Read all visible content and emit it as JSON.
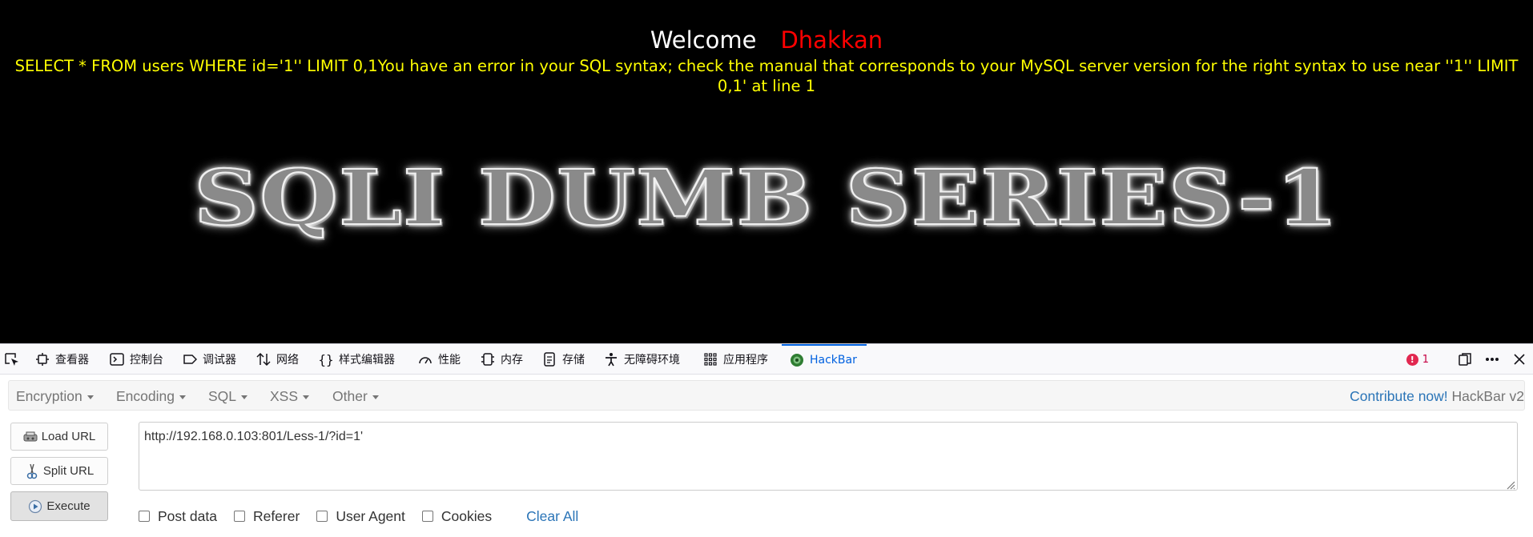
{
  "page": {
    "welcome": "Welcome",
    "user": "Dhakkan",
    "sql_error": "SELECT * FROM users WHERE id='1'' LIMIT 0,1You have an error in your SQL syntax; check the manual that corresponds to your MySQL server version for the right syntax to use near ''1'' LIMIT 0,1' at line 1",
    "banner": "SQLI DUMB SERIES-1"
  },
  "devtools": {
    "tabs": [
      {
        "label": "查看器",
        "icon": "inspector-icon"
      },
      {
        "label": "控制台",
        "icon": "console-icon"
      },
      {
        "label": "调试器",
        "icon": "debugger-icon"
      },
      {
        "label": "网络",
        "icon": "network-icon"
      },
      {
        "label": "样式编辑器",
        "icon": "style-editor-icon"
      },
      {
        "label": "性能",
        "icon": "performance-icon"
      },
      {
        "label": "内存",
        "icon": "memory-icon"
      },
      {
        "label": "存储",
        "icon": "storage-icon"
      },
      {
        "label": "无障碍环境",
        "icon": "accessibility-icon"
      },
      {
        "label": "应用程序",
        "icon": "application-icon"
      },
      {
        "label": "HackBar",
        "icon": "hackbar-icon",
        "active": true
      }
    ],
    "error_count": "1",
    "accent_color": "#0061e0"
  },
  "hackbar": {
    "menu": {
      "encryption": "Encryption",
      "encoding": "Encoding",
      "sql": "SQL",
      "xss": "XSS",
      "other": "Other",
      "contribute": "Contribute now!",
      "version": "HackBar v2"
    },
    "buttons": {
      "load_url": "Load URL",
      "split_url": "Split URL",
      "execute": "Execute"
    },
    "url": "http://192.168.0.103:801/Less-1/?id=1'",
    "options": {
      "post_data": "Post data",
      "referer": "Referer",
      "user_agent": "User Agent",
      "cookies": "Cookies",
      "clear_all": "Clear All"
    }
  }
}
